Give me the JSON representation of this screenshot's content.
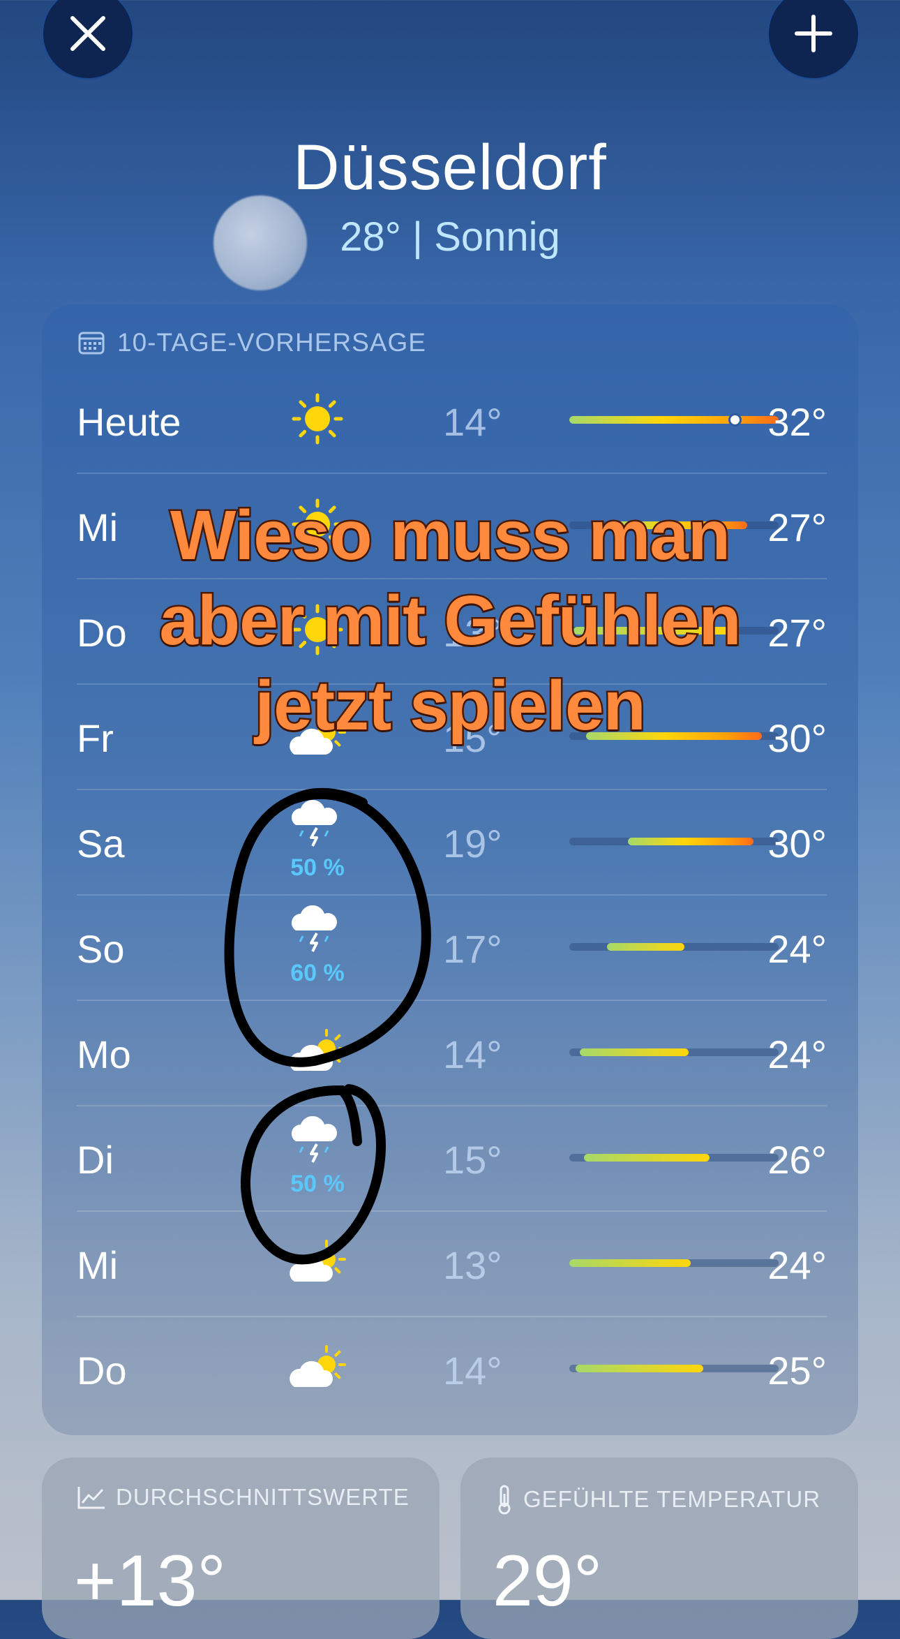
{
  "header": {
    "close_icon": "close-icon",
    "add_icon": "plus-icon"
  },
  "location": {
    "city": "Düsseldorf",
    "current": "28°  |  Sonnig"
  },
  "forecast": {
    "title": "10-TAGE-VORHERSAGE",
    "icon": "calendar-icon",
    "days": [
      {
        "day": "Heute",
        "icon": "sun-icon",
        "precip": "",
        "low": "14°",
        "high": "32°",
        "range": [
          0.0,
          1.0
        ],
        "current_marker": 0.79
      },
      {
        "day": "Mi",
        "icon": "sun-icon",
        "precip": "",
        "low": "",
        "high": "27°",
        "range": [
          0.18,
          0.85
        ]
      },
      {
        "day": "Do",
        "icon": "sun-icon",
        "precip": "",
        "low": "13°",
        "high": "27°",
        "range": [
          0.02,
          0.78
        ]
      },
      {
        "day": "Fr",
        "icon": "partly-sunny-icon",
        "precip": "",
        "low": "15°",
        "high": "30°",
        "range": [
          0.08,
          0.92
        ]
      },
      {
        "day": "Sa",
        "icon": "thunderstorm-icon",
        "precip": "50 %",
        "low": "19°",
        "high": "30°",
        "range": [
          0.28,
          0.88
        ]
      },
      {
        "day": "So",
        "icon": "thunderstorm-icon",
        "precip": "60 %",
        "low": "17°",
        "high": "24°",
        "range": [
          0.18,
          0.55
        ]
      },
      {
        "day": "Mo",
        "icon": "partly-sunny-icon",
        "precip": "",
        "low": "14°",
        "high": "24°",
        "range": [
          0.05,
          0.57
        ]
      },
      {
        "day": "Di",
        "icon": "thunderstorm-icon",
        "precip": "50 %",
        "low": "15°",
        "high": "26°",
        "range": [
          0.07,
          0.67
        ]
      },
      {
        "day": "Mi",
        "icon": "partly-sunny-icon",
        "precip": "",
        "low": "13°",
        "high": "24°",
        "range": [
          0.0,
          0.58
        ]
      },
      {
        "day": "Do",
        "icon": "partly-sunny-icon",
        "precip": "",
        "low": "14°",
        "high": "25°",
        "range": [
          0.03,
          0.64
        ]
      }
    ]
  },
  "averages": {
    "title": "DURCHSCHNITTSWERTE",
    "icon": "trend-chart-icon",
    "value": "+13°"
  },
  "feels_like": {
    "title": "GEFÜHLTE TEMPERATUR",
    "icon": "thermometer-icon",
    "value": "29°"
  },
  "overlay": {
    "lines": [
      "Wieso muss man",
      "aber mit Gefühlen",
      "jetzt spielen"
    ],
    "color": "#ff8a3d"
  },
  "colors": {
    "accent_rain": "#5ac8fa",
    "sun": "#ffd60a"
  }
}
